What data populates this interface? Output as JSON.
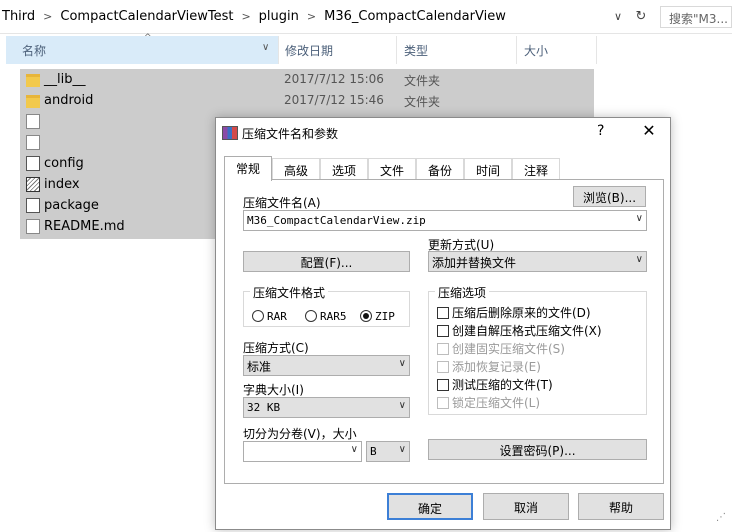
{
  "explorer": {
    "breadcrumb": [
      "Third",
      "CompactCalendarViewTest",
      "plugin",
      "M36_CompactCalendarView"
    ],
    "search_placeholder": "搜索\"M3...",
    "columns": {
      "name": "名称",
      "date": "修改日期",
      "type": "类型",
      "size": "大小"
    },
    "files": [
      {
        "name": "__lib__",
        "date": "2017/7/12 15:06",
        "type": "文件夹",
        "icon": "folder-icon"
      },
      {
        "name": "android",
        "date": "2017/7/12 15:46",
        "type": "文件夹",
        "icon": "folder-icon"
      },
      {
        "name": "",
        "date": "",
        "type": "",
        "icon": "document-icon"
      },
      {
        "name": "",
        "date": "",
        "type": "",
        "icon": "document-icon"
      },
      {
        "name": "config",
        "date": "",
        "type": "",
        "icon": "config-file-icon"
      },
      {
        "name": "index",
        "date": "",
        "type": "",
        "icon": "index-file-icon"
      },
      {
        "name": "package",
        "date": "",
        "type": "",
        "icon": "config-file-icon"
      },
      {
        "name": "README.md",
        "date": "",
        "type": "",
        "icon": "document-icon"
      }
    ]
  },
  "dialog": {
    "title": "压缩文件名和参数",
    "help": "?",
    "close": "✕",
    "tabs": [
      "常规",
      "高级",
      "选项",
      "文件",
      "备份",
      "时间",
      "注释"
    ],
    "active_tab": 0,
    "archive_name_label": "压缩文件名(A)",
    "browse_button": "浏览(B)...",
    "archive_name_value": "M36_CompactCalendarView.zip",
    "update_mode_label": "更新方式(U)",
    "update_mode_value": "添加并替换文件",
    "profile_button": "配置(F)...",
    "format_group_title": "压缩文件格式",
    "formats": [
      {
        "label": "RAR",
        "selected": false
      },
      {
        "label": "RAR5",
        "selected": false
      },
      {
        "label": "ZIP",
        "selected": true
      }
    ],
    "options_group_title": "压缩选项",
    "options": [
      {
        "label": "压缩后删除原来的文件(D)",
        "checked": false,
        "disabled": false
      },
      {
        "label": "创建自解压格式压缩文件(X)",
        "checked": false,
        "disabled": false
      },
      {
        "label": "创建固实压缩文件(S)",
        "checked": false,
        "disabled": true
      },
      {
        "label": "添加恢复记录(E)",
        "checked": false,
        "disabled": true
      },
      {
        "label": "测试压缩的文件(T)",
        "checked": false,
        "disabled": false
      },
      {
        "label": "锁定压缩文件(L)",
        "checked": false,
        "disabled": true
      }
    ],
    "method_label": "压缩方式(C)",
    "method_value": "标准",
    "dict_label": "字典大小(I)",
    "dict_value": "32 KB",
    "split_label": "切分为分卷(V)，大小",
    "split_value": "",
    "split_unit": "B",
    "password_button": "设置密码(P)...",
    "ok_button": "确定",
    "cancel_button": "取消",
    "help_button": "帮助"
  }
}
